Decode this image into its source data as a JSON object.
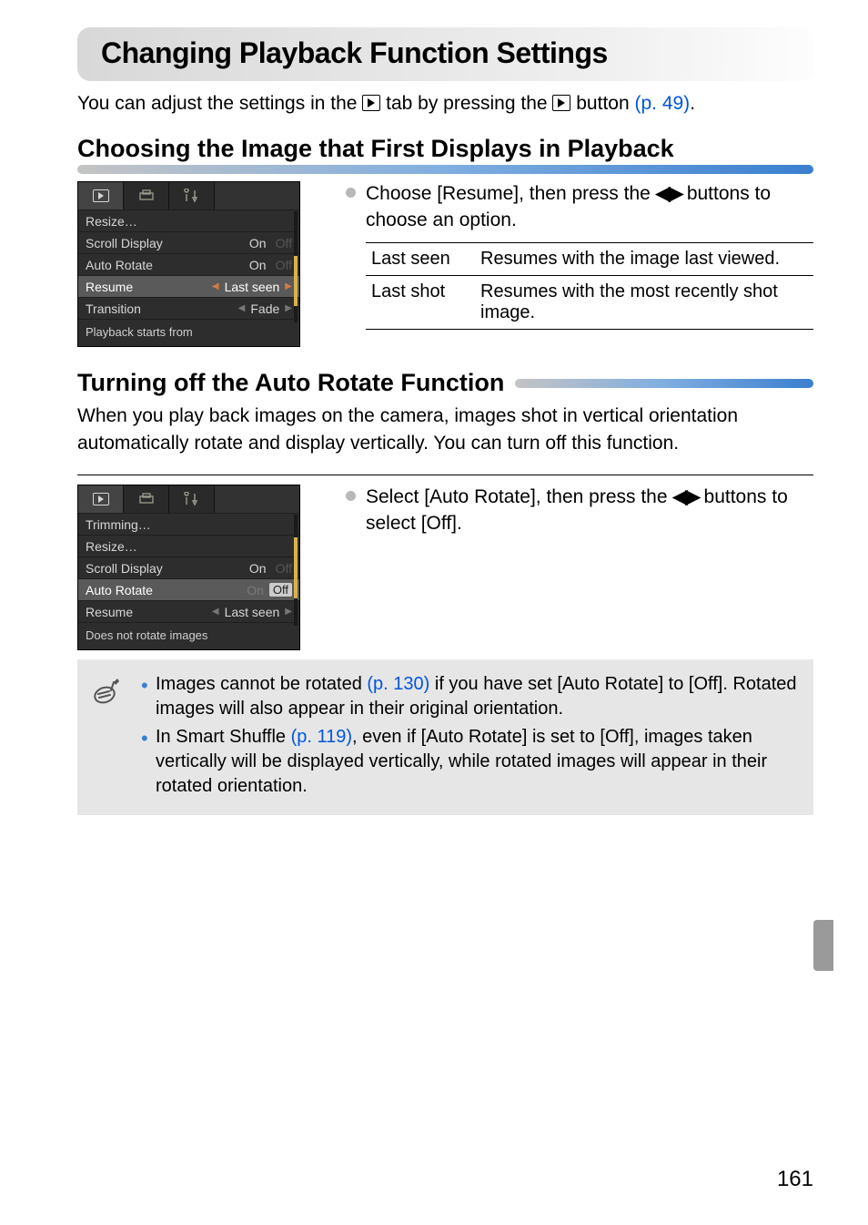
{
  "chapter_title": "Changing Playback Function Settings",
  "intro_a": "You can adjust the settings in the ",
  "intro_b": " tab by pressing the ",
  "intro_c": " button ",
  "intro_link": "(p. 49)",
  "intro_d": ".",
  "section1_title": "Choosing the Image that First Displays in Playback",
  "section1_instr_a": "Choose [Resume], then press the ",
  "section1_instr_b": " buttons to choose an option.",
  "resume_table": [
    {
      "k": "Last seen",
      "v": "Resumes with the image last viewed."
    },
    {
      "k": "Last shot",
      "v": "Resumes with the most recently shot image."
    }
  ],
  "lcd1": {
    "rows": [
      {
        "label": "Resize…",
        "value": ""
      },
      {
        "label": "Scroll Display",
        "value": "On",
        "dim": "Off"
      },
      {
        "label": "Auto Rotate",
        "value": "On",
        "dim": "Off"
      },
      {
        "label": "Resume",
        "value": "Last seen",
        "sel": true,
        "arrows": true
      },
      {
        "label": "Transition",
        "value": "Fade",
        "arrows": true
      }
    ],
    "hint": "Playback starts from"
  },
  "section2_title": "Turning off the Auto Rotate Function",
  "section2_intro": "When you play back images on the camera, images shot in vertical orientation automatically rotate and display vertically. You can turn off this function.",
  "section2_instr_a": "Select [Auto Rotate], then press the ",
  "section2_instr_b": " buttons to select [Off].",
  "lcd2": {
    "rows": [
      {
        "label": "Trimming…",
        "value": ""
      },
      {
        "label": "Resize…",
        "value": ""
      },
      {
        "label": "Scroll Display",
        "value": "On",
        "dim": "Off"
      },
      {
        "label": "Auto Rotate",
        "value_on": "On",
        "value_sel": "Off",
        "sel": true
      },
      {
        "label": "Resume",
        "value": "Last seen",
        "arrows": true
      }
    ],
    "hint": "Does not rotate images"
  },
  "notes": {
    "n1_a": "Images cannot be rotated ",
    "n1_link": "(p. 130)",
    "n1_b": " if you have set [Auto Rotate] to [Off]. Rotated images will also appear in their original orientation.",
    "n2_a": "In Smart Shuffle ",
    "n2_link": "(p. 119)",
    "n2_b": ", even if [Auto Rotate] is set to [Off], images taken vertically will be displayed vertically, while rotated images will appear in their rotated orientation."
  },
  "page_number": "161"
}
